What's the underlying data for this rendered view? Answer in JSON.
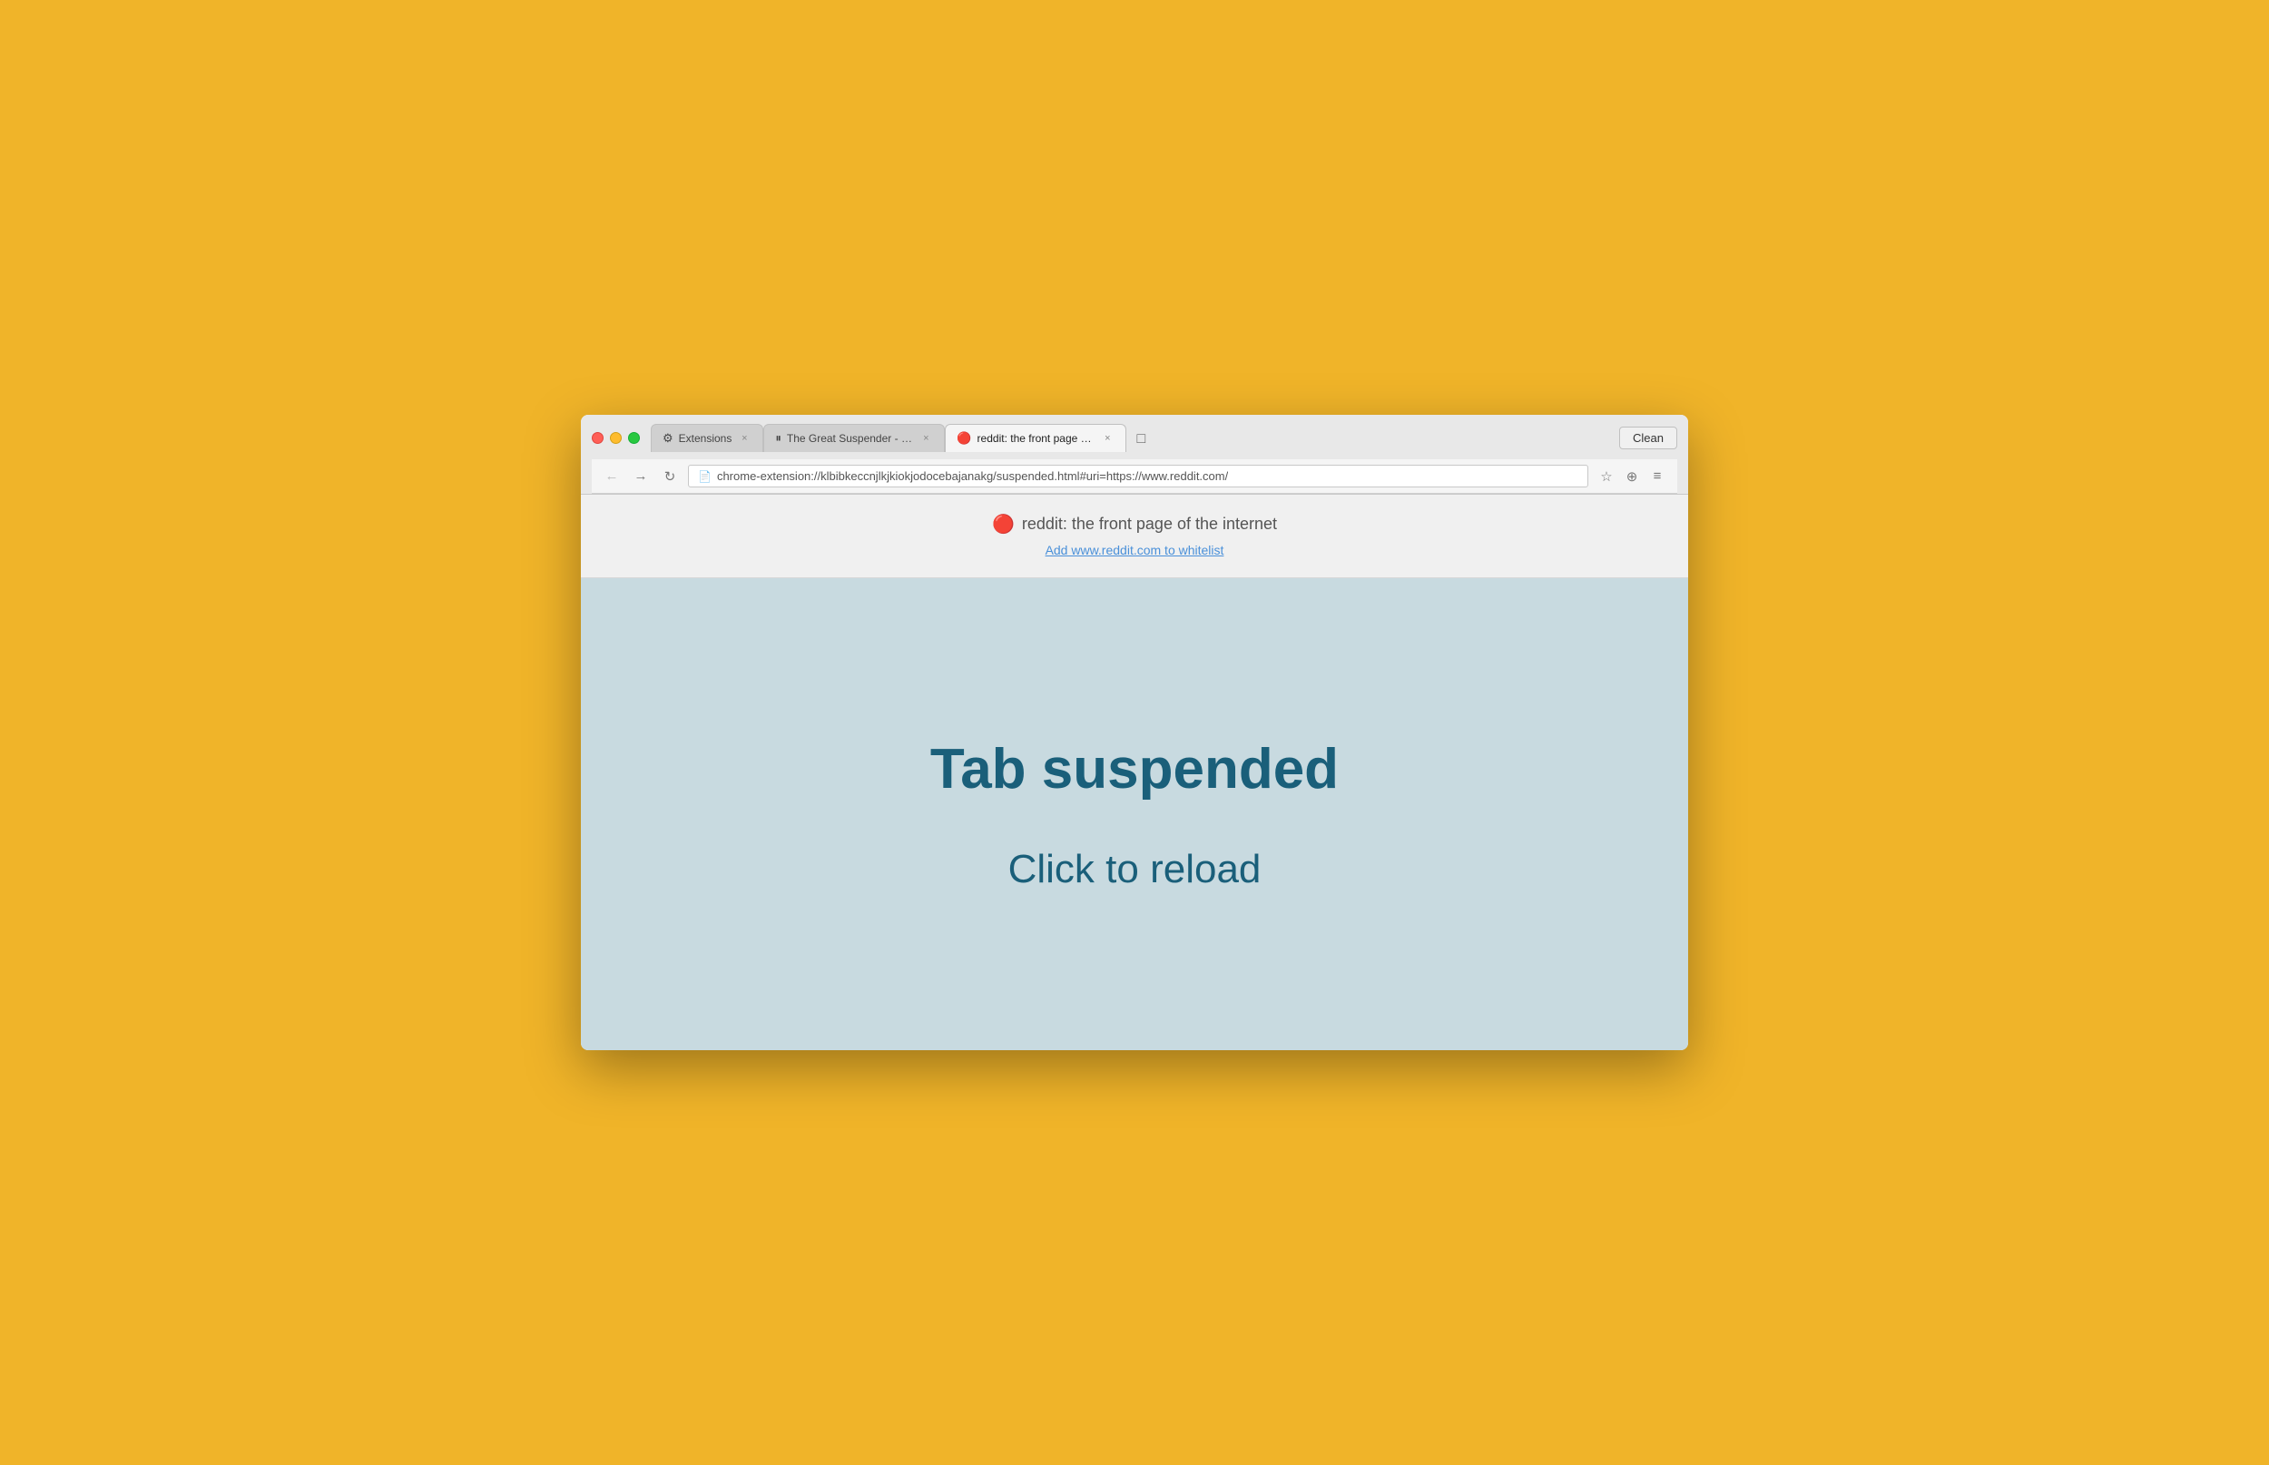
{
  "browser": {
    "clean_button": "Clean",
    "tabs": [
      {
        "id": "extensions",
        "icon": "⚙",
        "label": "Extensions",
        "active": false,
        "closable": true
      },
      {
        "id": "great-suspender",
        "icon": "⏸",
        "label": "The Great Suspender - Chi",
        "active": false,
        "closable": true
      },
      {
        "id": "reddit-suspended",
        "icon": "🔴",
        "label": "reddit: the front page of th",
        "active": true,
        "closable": true
      },
      {
        "id": "new-tab",
        "icon": "",
        "label": "",
        "active": false,
        "closable": false
      }
    ],
    "address_bar": {
      "url": "chrome-extension://klbibkeccnjlkjkiokjodocebajanakg/suspended.html#uri=https://www.reddit.com/",
      "placeholder": ""
    }
  },
  "page_header": {
    "reddit_icon": "🔴",
    "title": "reddit: the front page of the internet",
    "whitelist_link": "Add www.reddit.com to whitelist"
  },
  "page_content": {
    "suspended_title": "Tab suspended",
    "reload_text": "Click to reload"
  },
  "colors": {
    "background": "#F0B429",
    "browser_bg": "#e8e8e8",
    "content_bg": "#c8dae0",
    "text_dark": "#1a5f7a"
  }
}
